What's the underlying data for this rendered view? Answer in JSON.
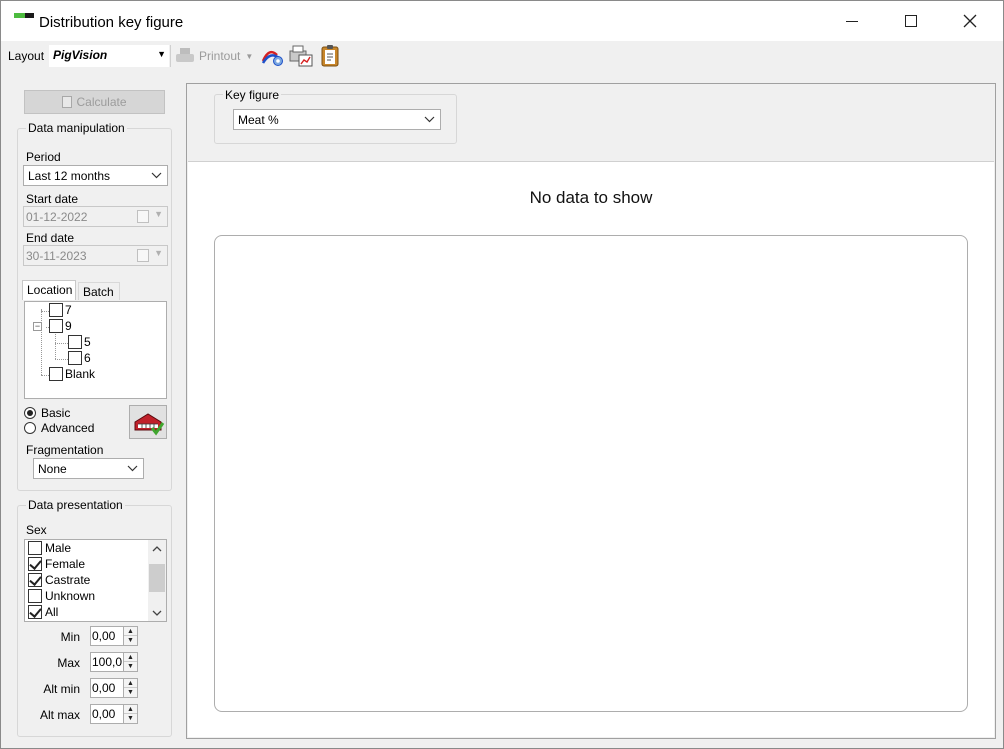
{
  "window": {
    "title": "Distribution key figure",
    "accent_green": "#4dbb3f"
  },
  "toolbar": {
    "layout_label": "Layout",
    "layout_value": "PigVision",
    "printout_label": "Printout",
    "icons": [
      "chart-settings-icon",
      "print-preview-icon",
      "clipboard-icon"
    ]
  },
  "left": {
    "calculate_label": "Calculate",
    "data_manipulation_title": "Data manipulation",
    "period_label": "Period",
    "period_value": "Last 12 months",
    "start_date_label": "Start date",
    "start_date_value": "01-12-2022",
    "end_date_label": "End date",
    "end_date_value": "30-11-2023",
    "tabs": [
      "Location",
      "Batch"
    ],
    "tree": [
      {
        "label": "7",
        "level": 0
      },
      {
        "label": "9",
        "level": 0,
        "expanded": true
      },
      {
        "label": "5",
        "level": 1
      },
      {
        "label": "6",
        "level": 1
      },
      {
        "label": "Blank",
        "level": 0
      }
    ],
    "basic_label": "Basic",
    "advanced_label": "Advanced",
    "mode_selected": "Basic",
    "fragmentation_label": "Fragmentation",
    "fragmentation_value": "None",
    "data_presentation_title": "Data presentation",
    "sex_label": "Sex",
    "sex_items": [
      {
        "label": "Male",
        "checked": false
      },
      {
        "label": "Female",
        "checked": true
      },
      {
        "label": "Castrate",
        "checked": true
      },
      {
        "label": "Unknown",
        "checked": false
      },
      {
        "label": "All",
        "checked": true
      }
    ],
    "min_label": "Min",
    "min_value": "0,00",
    "max_label": "Max",
    "max_value": "100,0",
    "alt_min_label": "Alt min",
    "alt_min_value": "0,00",
    "alt_max_label": "Alt max",
    "alt_max_value": "0,00"
  },
  "main": {
    "key_figure_label": "Key figure",
    "key_figure_value": "Meat %",
    "no_data_text": "No data to show"
  }
}
